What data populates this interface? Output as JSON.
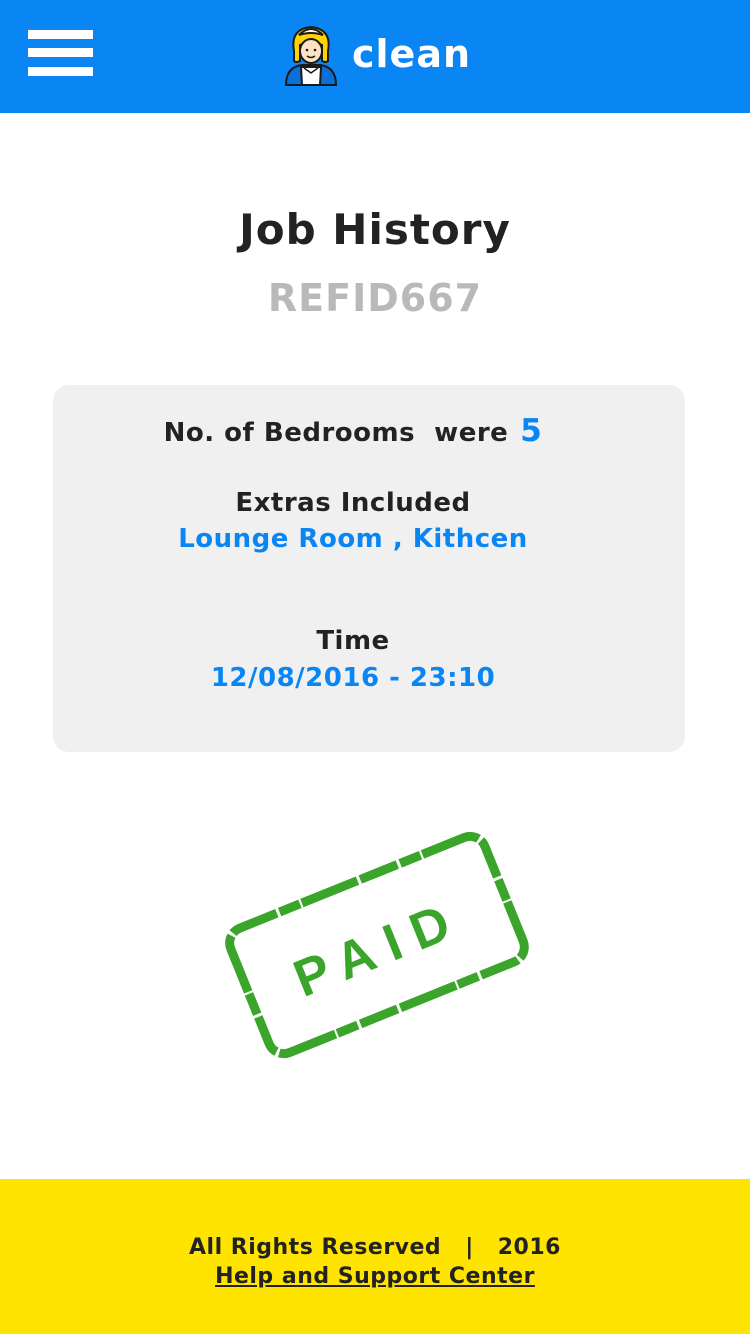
{
  "header": {
    "menu_icon": "hamburger-menu-icon",
    "logo_icon": "maid-avatar-icon",
    "brand_name": "clean",
    "background_color": "#0a86f4"
  },
  "main": {
    "title": "Job History",
    "reference_id": "REFID667"
  },
  "job_card": {
    "bedrooms_label": "No. of Bedrooms  were",
    "bedrooms_value": "5",
    "extras_label": "Extras Included",
    "extras_value": "Lounge Room , Kithcen",
    "time_label": "Time",
    "time_value": "12/08/2016 - 23:10",
    "value_color": "#0a86f4"
  },
  "status_stamp": {
    "text": "PAID",
    "icon": "paid-stamp-icon",
    "color": "#3aa52a"
  },
  "footer": {
    "rights_text": "All Rights Reserved",
    "separator": "|",
    "year": "2016",
    "help_link": "Help and Support Center",
    "background_color": "#ffe400"
  }
}
